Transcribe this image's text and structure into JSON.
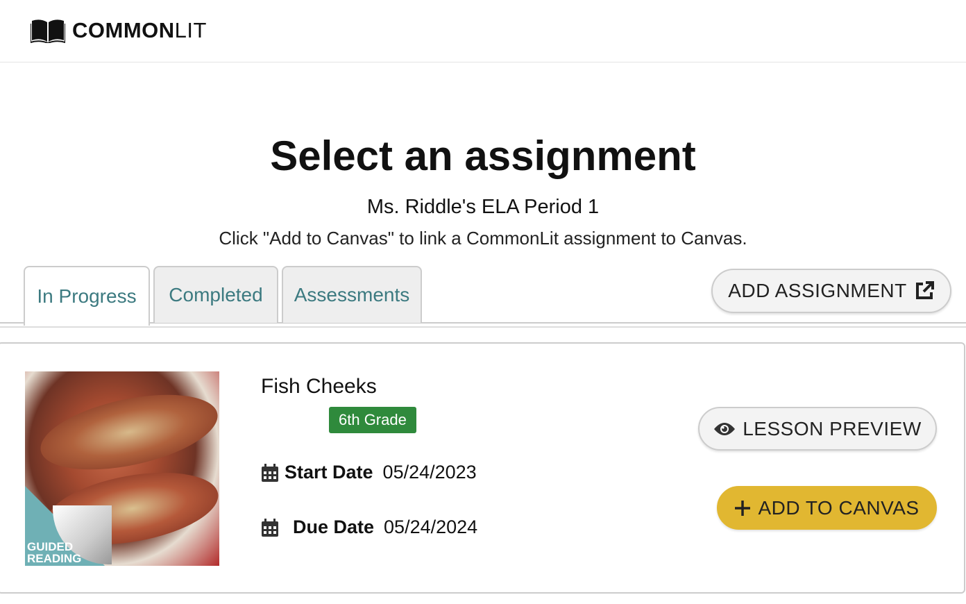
{
  "header": {
    "brand_bold": "COMMON",
    "brand_light": "LIT",
    "logo_icon": "open-book-icon"
  },
  "page": {
    "title": "Select an assignment",
    "class_name": "Ms. Riddle's ELA Period 1",
    "instructions": "Click \"Add to Canvas\" to link a CommonLit assignment to Canvas."
  },
  "tabs": [
    {
      "label": "In Progress",
      "active": true
    },
    {
      "label": "Completed",
      "active": false
    },
    {
      "label": "Assessments",
      "active": false
    }
  ],
  "add_assignment": {
    "label": "ADD ASSIGNMENT",
    "icon": "external-link-icon"
  },
  "assignments": [
    {
      "title": "Fish Cheeks",
      "grade": "6th Grade",
      "thumbnail_overlay": "GUIDED READING",
      "start_label": "Start Date",
      "start_date": "05/24/2023",
      "due_label": "Due Date",
      "due_date": "05/24/2024",
      "preview_label": "LESSON PREVIEW",
      "add_label": "ADD TO CANVAS"
    }
  ],
  "colors": {
    "tab_text": "#3c7a80",
    "grade_badge": "#2f8a3c",
    "add_to_canvas": "#e1b731"
  }
}
